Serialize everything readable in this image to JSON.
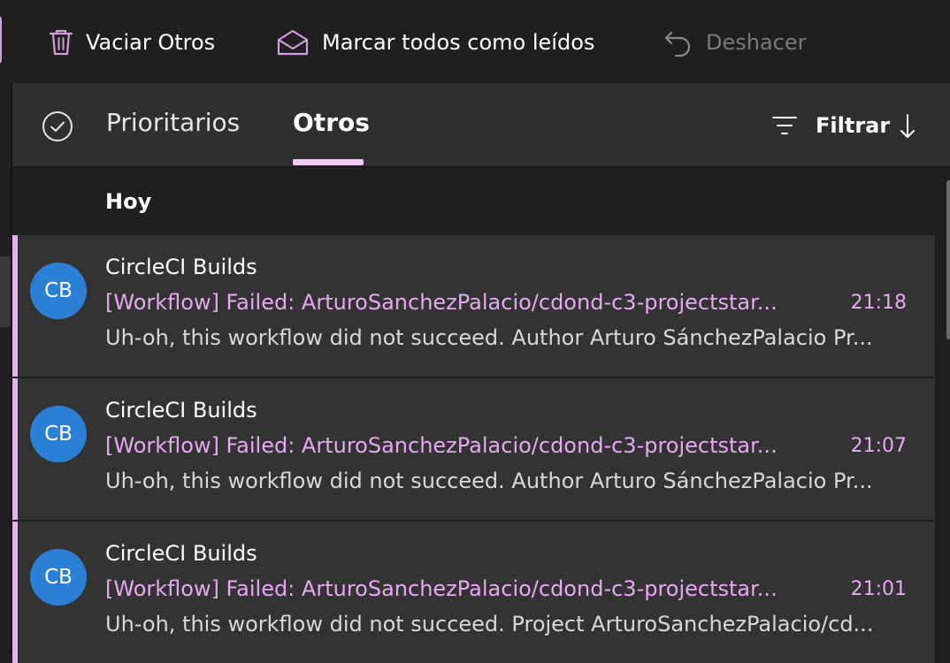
{
  "toolbar": {
    "empty_label": "Vaciar Otros",
    "mark_all_read_label": "Marcar todos como leídos",
    "undo_label": "Deshacer"
  },
  "tabs": {
    "focused": "Prioritarios",
    "other": "Otros",
    "filter": "Filtrar"
  },
  "group": {
    "title": "Hoy"
  },
  "messages": [
    {
      "initials": "CB",
      "sender": "CircleCI Builds",
      "subject": "[Workflow] Failed: ArturoSanchezPalacio/cdond-c3-projectstar...",
      "time": "21:18",
      "preview": "Uh-oh, this workflow did not succeed. Author Arturo SánchezPalacio Pr..."
    },
    {
      "initials": "CB",
      "sender": "CircleCI Builds",
      "subject": "[Workflow] Failed: ArturoSanchezPalacio/cdond-c3-projectstar...",
      "time": "21:07",
      "preview": "Uh-oh, this workflow did not succeed. Author Arturo SánchezPalacio Pr..."
    },
    {
      "initials": "CB",
      "sender": "CircleCI Builds",
      "subject": "[Workflow] Failed: ArturoSanchezPalacio/cdond-c3-projectstar...",
      "time": "21:01",
      "preview": "Uh-oh, this workflow did not succeed. Project ArturoSanchezPalacio/cd..."
    }
  ],
  "colors": {
    "accent": "#e5b2f0",
    "avatar": "#2b7fd4",
    "background": "#1f1f1f"
  },
  "icons": {
    "empty": "trash-icon",
    "mark_read": "envelope-open-icon",
    "undo": "undo-icon",
    "select": "check-circle-icon",
    "filter": "filter-icon",
    "sort": "arrow-down-icon"
  }
}
